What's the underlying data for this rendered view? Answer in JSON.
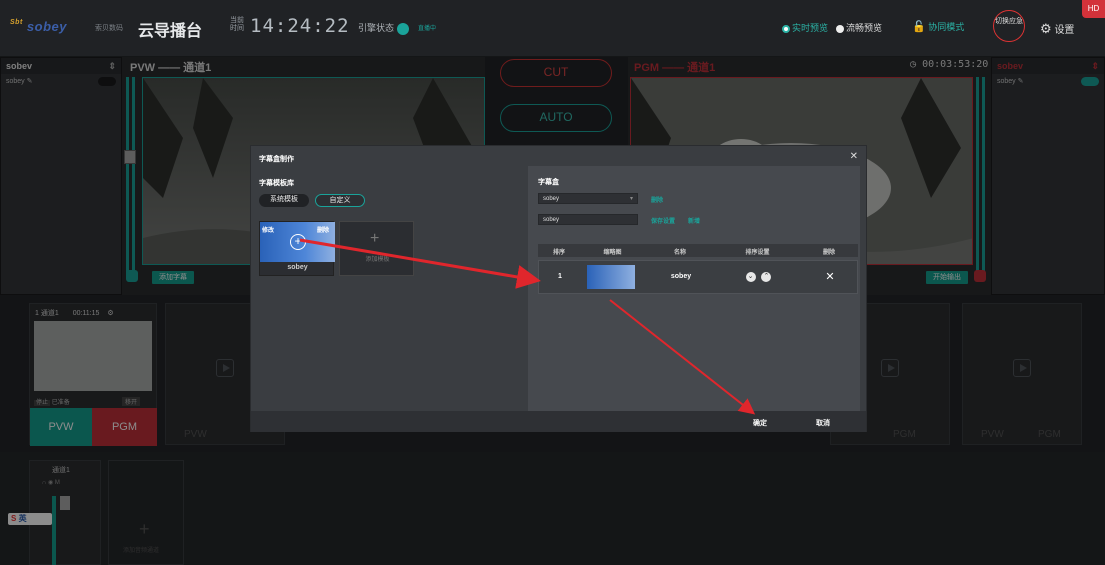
{
  "topbar": {
    "logo": "sobey",
    "logo_prefix": "Sbt",
    "logo_sub": "索贝数码",
    "app_title": "云导播台",
    "time_label": "当前时间",
    "clock": "14:24:22",
    "stream_label": "引擎状态",
    "stream_status": "直播中",
    "live_preview": "实时预览",
    "smooth_preview": "流畅预览",
    "collab_mode": "协同模式",
    "switch_emergency": "切换应急",
    "settings": "设置",
    "hd": "HD"
  },
  "left_panel": {
    "title": "sobev",
    "item": "sobey",
    "arrow": "⇕"
  },
  "right_panel": {
    "title": "sobev",
    "item": "sobey",
    "arrow": "⇕"
  },
  "pvw": {
    "title": "PVW —— 通道1",
    "add_caption": "添加字幕"
  },
  "pgm": {
    "title": "PGM —— 通道1",
    "timer": "00:03:53:20",
    "start_output": "开始输出"
  },
  "controls": {
    "cut": "CUT",
    "auto": "AUTO"
  },
  "channel1": {
    "name": "1 通道1",
    "time": "00:11:15",
    "stop": "停止",
    "status": "已准备",
    "remove": "移开",
    "pvw": "PVW",
    "pgm": "PGM"
  },
  "slot_labels": {
    "pvw": "PVW",
    "pgm": "PGM"
  },
  "audio": {
    "name": "通道1",
    "icons": "∩ ◉ M",
    "add_audio": "添加音频通道"
  },
  "ime": {
    "label": "英"
  },
  "dialog": {
    "title": "字幕盒制作",
    "lib_title": "字幕模板库",
    "tab_system": "系统模板",
    "tab_custom": "自定义",
    "card_edit": "修改",
    "card_delete": "删除",
    "card_name": "sobey",
    "add_card": "添加模板",
    "box_title": "字幕盒",
    "select_value": "sobey",
    "delete_link": "删除",
    "name_value": "sobey",
    "save_link": "保存设置",
    "new_link": "新增",
    "table": {
      "headers": [
        "排序",
        "缩略图",
        "名称",
        "排序设置",
        "删除"
      ],
      "rows": [
        {
          "order": "1",
          "name": "sobey"
        }
      ]
    },
    "confirm": "确定",
    "cancel": "取消"
  },
  "colors": {
    "accent": "#1aa39a",
    "red": "#c0313a",
    "arrow": "#e0262c"
  }
}
